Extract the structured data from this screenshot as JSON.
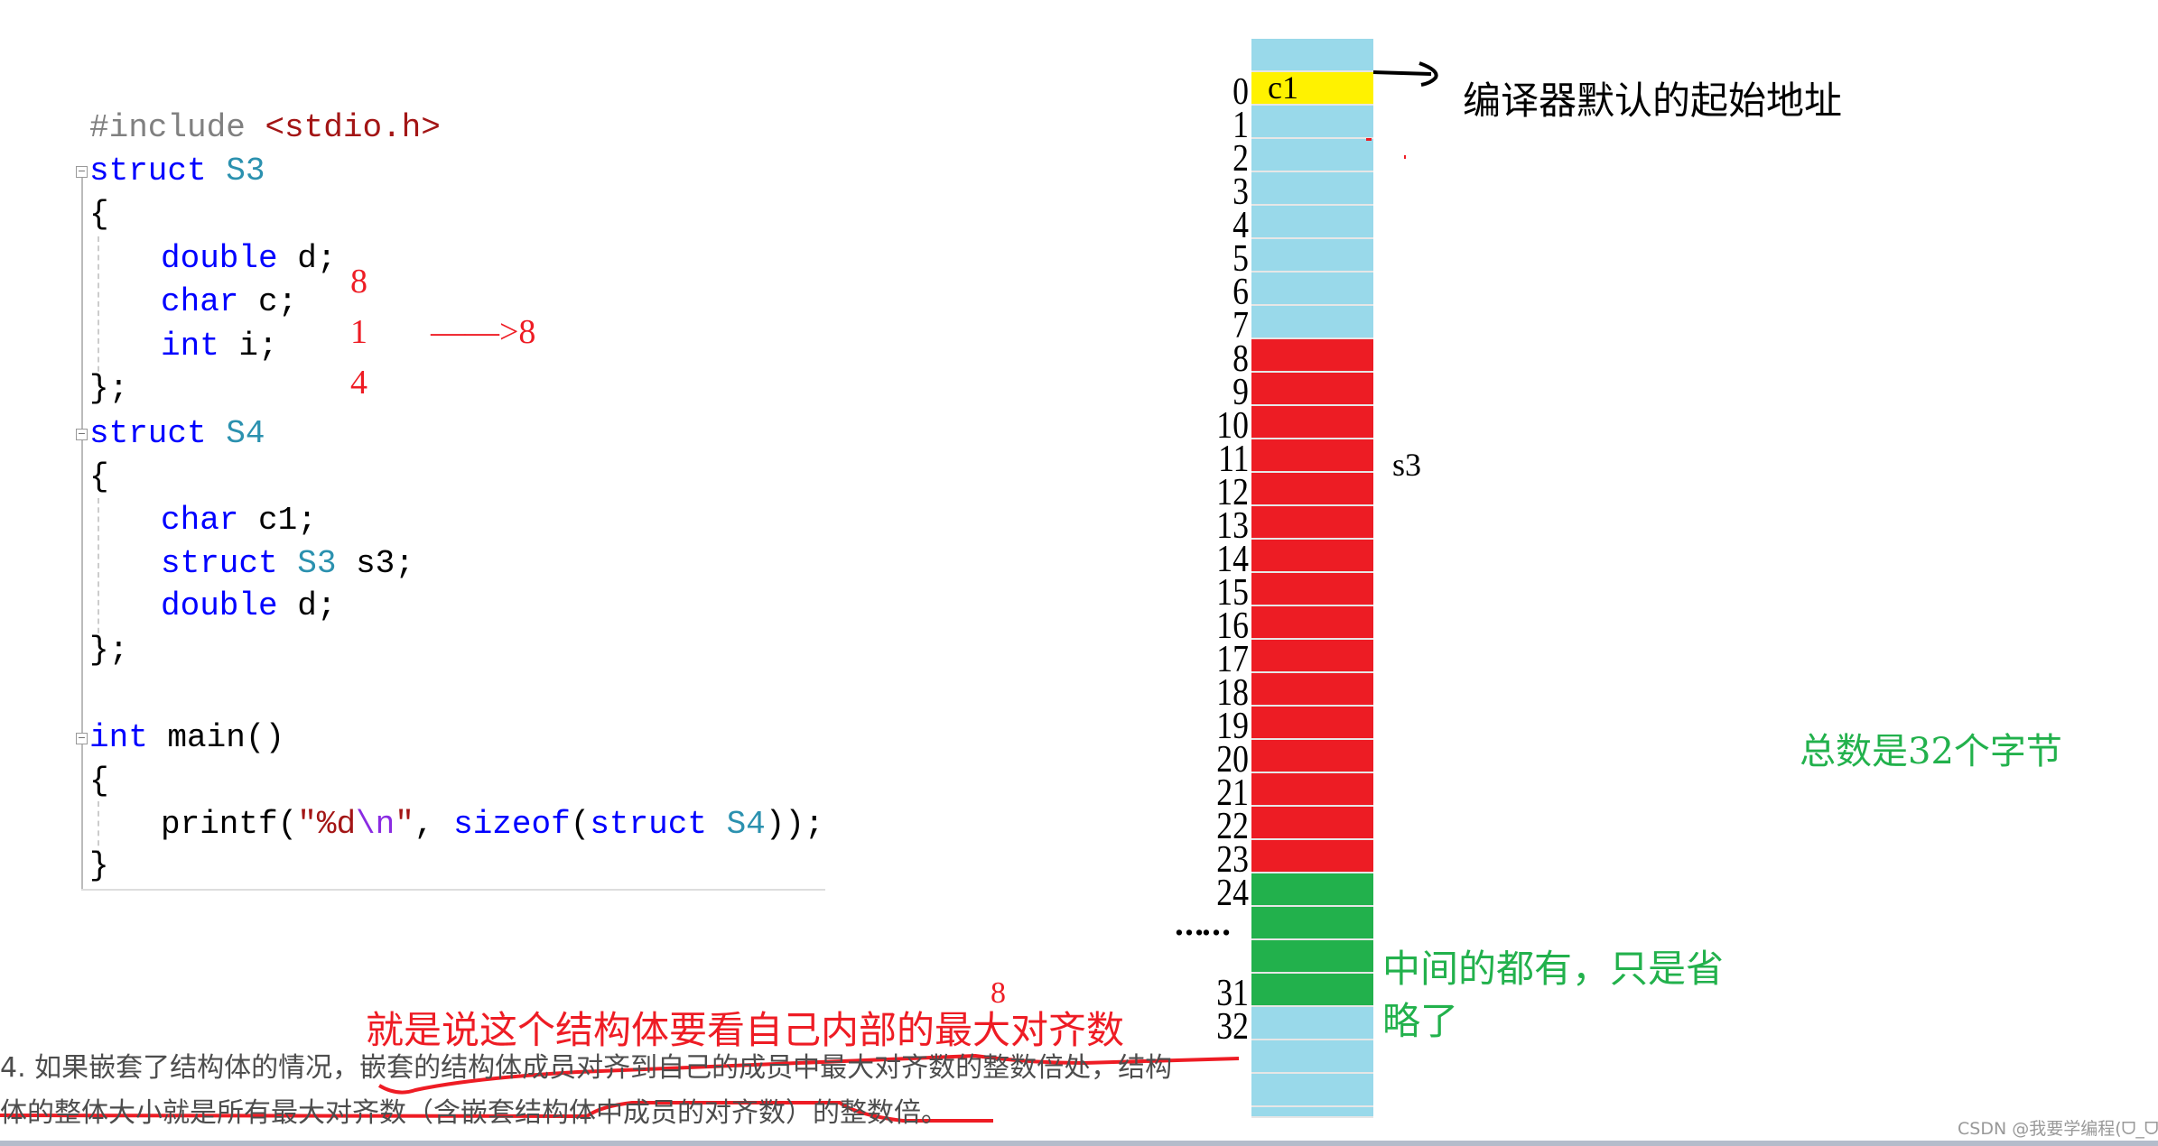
{
  "code": {
    "include_directive": "#include",
    "include_header": "<stdio.h>",
    "struct_kw": "struct",
    "s3_name": "S3",
    "s4_name": "S4",
    "open_brace": "{",
    "close_brace": "};",
    "close_brace_plain": "}",
    "s3_members": [
      {
        "type": "double",
        "name": "d;"
      },
      {
        "type": "char",
        "name": "c;"
      },
      {
        "type": "int",
        "name": "i;"
      }
    ],
    "s4_members": [
      {
        "type": "char",
        "name": "c1;"
      },
      {
        "type": "struct",
        "type2": "S3",
        "name": "s3;"
      },
      {
        "type": "double",
        "name": "d;"
      }
    ],
    "main_kw": "int",
    "main_sig": "main()",
    "printf_fn": "printf(",
    "printf_fmt": "\"%d",
    "printf_nl": "\\n",
    "printf_q": "\"",
    "printf_comma": ", ",
    "sizeof_kw": "sizeof",
    "sizeof_open": "(",
    "sizeof_struct": "struct",
    "sizeof_type": "S4",
    "sizeof_close": "));"
  },
  "annotations": {
    "s3_alignments": [
      "8",
      "1",
      "4"
    ],
    "s3_arrow": "——>8",
    "start_address": "编译器默认的起始地址",
    "s3_label": "s3",
    "total": "总数是32个字节",
    "omitted": [
      "中间的都有，只是省",
      "略了"
    ],
    "red_note": "就是说这个结构体要看自己内部的最大对齐数",
    "red_note_num": "8",
    "c1_label": "c1",
    "dots": "……"
  },
  "paragraph": {
    "line1": "4. 如果嵌套了结构体的情况，嵌套的结构体成员对齐到自己的成员中最大对齐数的整数倍处，结构",
    "line2": "体的整体大小就是所有最大对齐数（含嵌套结构体中成员的对齐数）的整数倍。"
  },
  "watermark": "CSDN @我要学编程(ᗜ_ᗜ)",
  "colors": {
    "free": "#99d9ea",
    "c1": "#fff200",
    "s3": "#ed1c24",
    "d": "#22b14c"
  },
  "memory": [
    {
      "label": "",
      "fill": "free"
    },
    {
      "label": "0",
      "fill": "c1"
    },
    {
      "label": "1",
      "fill": "free"
    },
    {
      "label": "2",
      "fill": "free"
    },
    {
      "label": "3",
      "fill": "free"
    },
    {
      "label": "4",
      "fill": "free"
    },
    {
      "label": "5",
      "fill": "free"
    },
    {
      "label": "6",
      "fill": "free"
    },
    {
      "label": "7",
      "fill": "free"
    },
    {
      "label": "8",
      "fill": "s3"
    },
    {
      "label": "9",
      "fill": "s3"
    },
    {
      "label": "10",
      "fill": "s3"
    },
    {
      "label": "11",
      "fill": "s3"
    },
    {
      "label": "12",
      "fill": "s3"
    },
    {
      "label": "13",
      "fill": "s3"
    },
    {
      "label": "14",
      "fill": "s3"
    },
    {
      "label": "15",
      "fill": "s3"
    },
    {
      "label": "16",
      "fill": "s3"
    },
    {
      "label": "17",
      "fill": "s3"
    },
    {
      "label": "18",
      "fill": "s3"
    },
    {
      "label": "19",
      "fill": "s3"
    },
    {
      "label": "20",
      "fill": "s3"
    },
    {
      "label": "21",
      "fill": "s3"
    },
    {
      "label": "22",
      "fill": "s3"
    },
    {
      "label": "23",
      "fill": "s3"
    },
    {
      "label": "24",
      "fill": "d"
    },
    {
      "label": "",
      "fill": "d"
    },
    {
      "label": "",
      "fill": "d"
    },
    {
      "label": "31",
      "fill": "d"
    },
    {
      "label": "32",
      "fill": "free"
    },
    {
      "label": "",
      "fill": "free"
    },
    {
      "label": "",
      "fill": "free"
    },
    {
      "label": "",
      "fill": "free"
    }
  ]
}
